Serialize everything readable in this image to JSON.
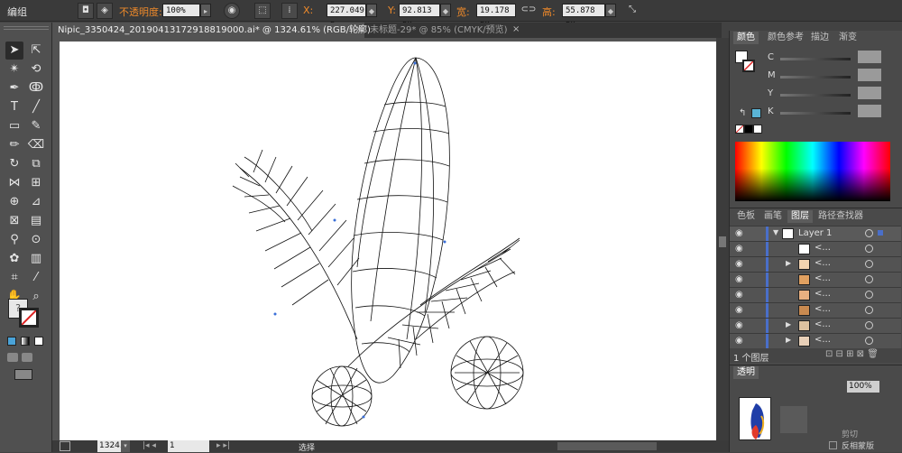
{
  "control_bar": {
    "mode_label": "编组",
    "opacity_label": "不透明度:",
    "opacity_value": "100%",
    "x_label": "X:",
    "x_value": "227.049 p",
    "y_label": "Y:",
    "y_value": "92.813 px",
    "w_label": "宽:",
    "w_value": "19.178 px",
    "h_label": "高:",
    "h_value": "55.878 px"
  },
  "tabs": [
    {
      "label": "Nipic_3350424_20190413172918819000.ai* @ 1324.61% (RGB/轮廓)",
      "active": true,
      "close": "×"
    },
    {
      "label": "未标题-29* @ 85% (CMYK/预览)",
      "active": false,
      "close": "×"
    }
  ],
  "color_panel": {
    "tabs": [
      "颜色",
      "颜色参考",
      "描边",
      "渐变"
    ],
    "active_tab": "颜色",
    "channels": [
      "C",
      "M",
      "Y",
      "K"
    ]
  },
  "layers_panel": {
    "tabs": [
      "色板",
      "画笔",
      "图层",
      "路径查找器"
    ],
    "active_tab": "图层",
    "layer_name": "Layer 1",
    "sublayers": [
      "<...",
      "<...",
      "<...",
      "<...",
      "<...",
      "<...",
      "<..."
    ],
    "footer": "1 个图层"
  },
  "transparency_panel": {
    "title": "透明",
    "value": "100%",
    "label1": "剪切",
    "label2": "反相蒙版"
  },
  "status_bar": {
    "zoom": "1324.6",
    "page": "1",
    "tool": "选择"
  },
  "icons": [
    "selection-tool-icon",
    "direct-selection-icon",
    "pen-icon",
    "type-icon",
    "rectangle-icon",
    "brush-icon",
    "rotate-icon",
    "eyedropper-icon",
    "hand-icon",
    "zoom-icon"
  ]
}
